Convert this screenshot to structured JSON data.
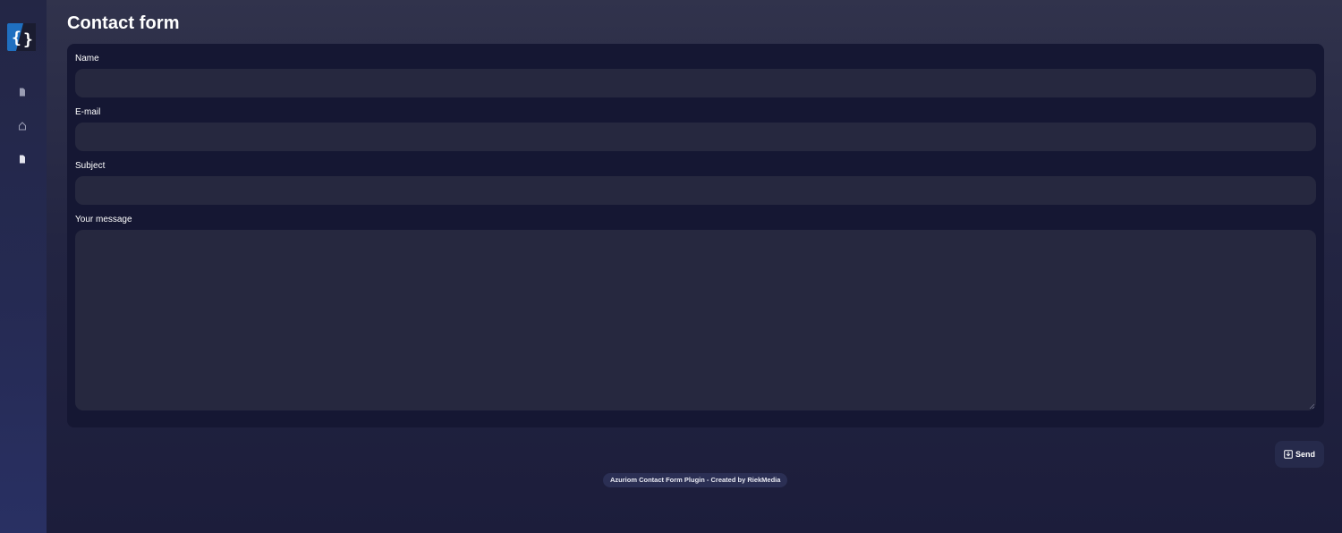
{
  "sidebar": {
    "logo_icon": "curly-braces-logo-icon",
    "items": [
      {
        "icon": "file-icon"
      },
      {
        "icon": "home-icon"
      },
      {
        "icon": "file-icon"
      }
    ]
  },
  "page": {
    "title": "Contact form"
  },
  "form": {
    "name_label": "Name",
    "name_value": "",
    "email_label": "E-mail",
    "email_value": "",
    "subject_label": "Subject",
    "subject_value": "",
    "message_label": "Your message",
    "message_value": "",
    "send_label": "Send",
    "send_icon": "download-box-icon"
  },
  "footer": {
    "credit": "Azuriom Contact Form Plugin - Created by RiekMedia"
  },
  "colors": {
    "page_bg_top": "#31334c",
    "page_bg_bottom": "#1c1d3b",
    "sidebar_bg": "#252a52",
    "card_bg": "#151733",
    "input_bg": "#26283f",
    "logo_blue": "#1f6fc0"
  }
}
